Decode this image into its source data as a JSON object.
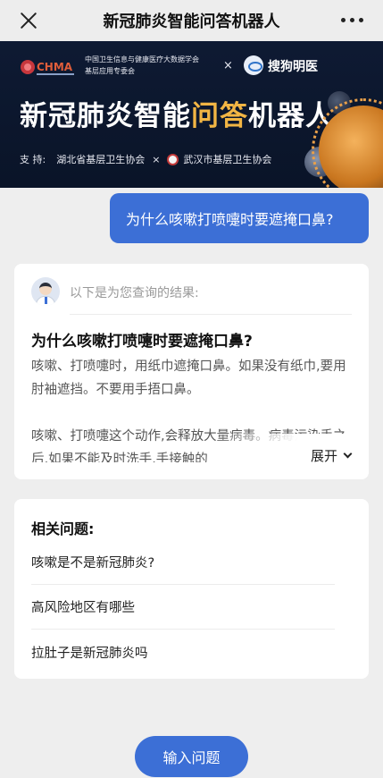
{
  "navbar": {
    "title": "新冠肺炎智能问答机器人",
    "close_icon": "close-icon",
    "more_icon": "more-dots-icon"
  },
  "banner": {
    "org_line1": "中国卫生信息与健康医疗大数据学会",
    "org_line2": "基层应用专委会",
    "cross": "×",
    "partner": "搜狗明医",
    "title_a": "新冠肺炎智能",
    "title_highlight": "问答",
    "title_b": "机器人",
    "support_label": "支 持:",
    "support_org1": "湖北省基层卫生协会",
    "support_cross": "×",
    "support_org2": "武汉市基层卫生协会",
    "highlight_color": "#f2b544"
  },
  "chat": {
    "user_question": "为什么咳嗽打喷嚏时要遮掩口鼻?",
    "result_hint": "以下是为您查询的结果:",
    "answer_title": "为什么咳嗽打喷嚏时要遮掩口鼻?",
    "answer_para1": "咳嗽、打喷嚏时，用纸巾遮掩口鼻。如果没有纸巾,要用肘袖遮挡。不要用手捂口鼻。",
    "answer_para2": "咳嗽、打喷嚏这个动作,会释放大量病毒。病毒污染手之后,如果不能及时洗手,手接触的",
    "expand_label": "展开"
  },
  "related": {
    "title": "相关问题:",
    "items": [
      "咳嗽是不是新冠肺炎?",
      "高风险地区有哪些",
      "拉肚子是新冠肺炎吗"
    ]
  },
  "bottom": {
    "input_button": "输入问题"
  },
  "colors": {
    "accent": "#3c6fd6",
    "banner_bg": "#0e1a33"
  }
}
